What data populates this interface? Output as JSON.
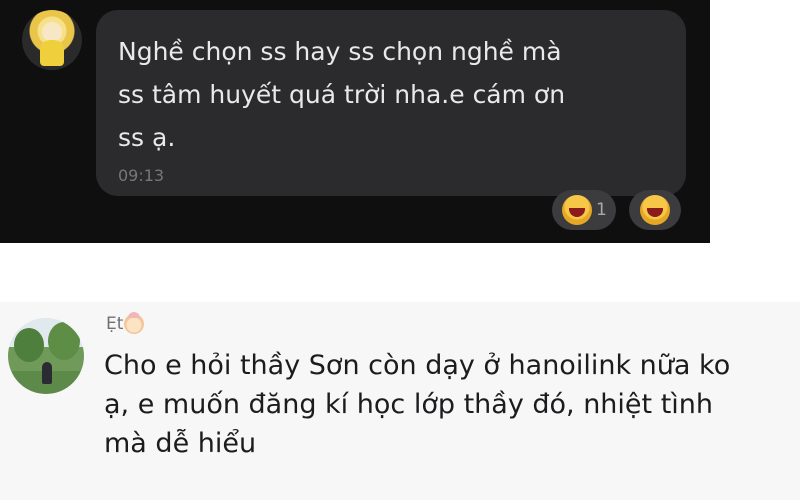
{
  "chat_message": {
    "text_lines": [
      "Nghề chọn ss hay ss chọn nghề mà",
      "ss tâm huyết quá trời nha.e cám ơn",
      "ss ạ."
    ],
    "time": "09:13",
    "reactions": [
      {
        "icon": "haha-reaction-icon",
        "count": "1"
      },
      {
        "icon": "haha-reaction-icon",
        "count": ""
      }
    ]
  },
  "comment": {
    "author": "Ẹt",
    "author_emoji": "baby-emoji-icon",
    "text_lines": [
      "Cho e hỏi thầy Sơn còn dạy ở hanoilink nữa ko",
      "ạ, e muốn đăng kí học lớp thầy đó, nhiệt tình",
      "mà dễ hiểu"
    ]
  },
  "colors": {
    "dark_background": "#0f0f10",
    "dark_bubble": "#2b2b2d",
    "light_background": "#f7f7f8"
  }
}
